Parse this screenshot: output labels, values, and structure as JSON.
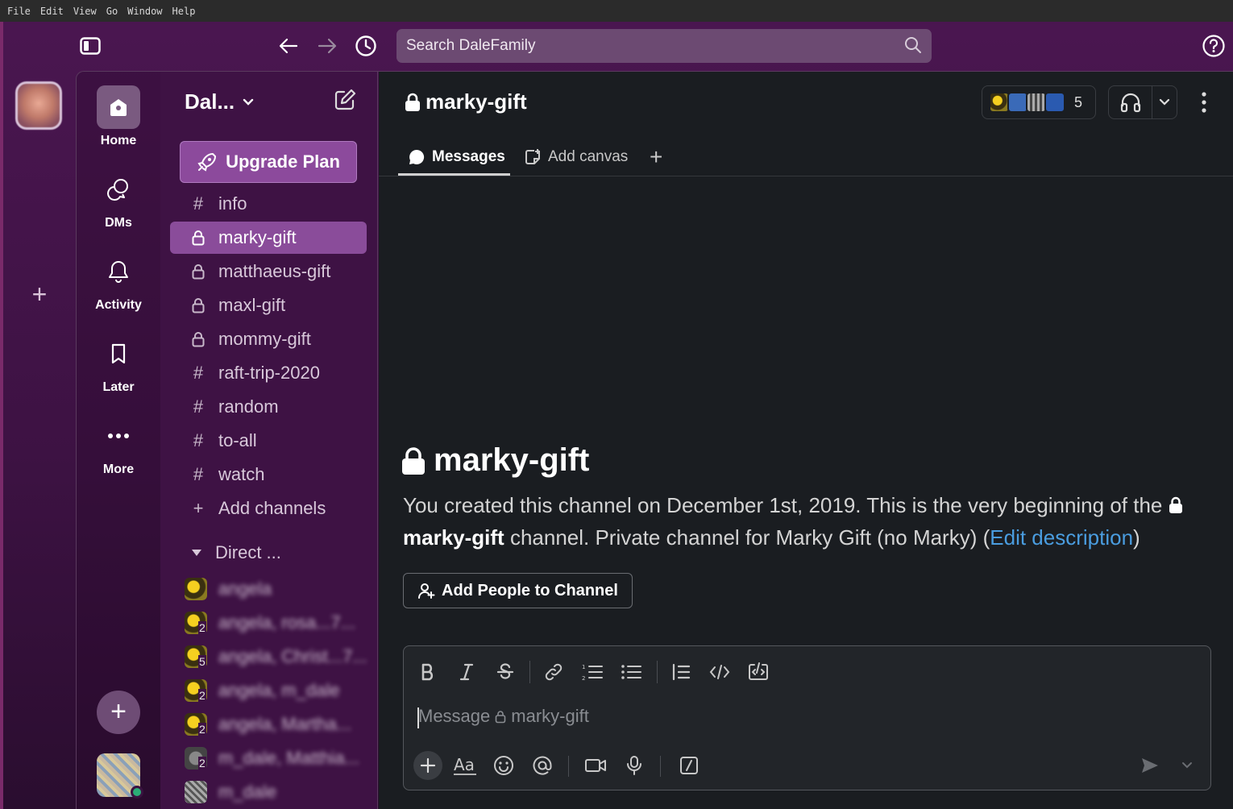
{
  "os_menu": [
    "File",
    "Edit",
    "View",
    "Go",
    "Window",
    "Help"
  ],
  "topbar": {
    "search_placeholder": "Search DaleFamily"
  },
  "nav": {
    "home": "Home",
    "dms": "DMs",
    "activity": "Activity",
    "later": "Later",
    "more": "More"
  },
  "sidebar": {
    "workspace_name": "Dal...",
    "upgrade_label": "Upgrade Plan",
    "channels": [
      {
        "name": "info",
        "type": "public"
      },
      {
        "name": "marky-gift",
        "type": "private",
        "active": true
      },
      {
        "name": "matthaeus-gift",
        "type": "private"
      },
      {
        "name": "maxl-gift",
        "type": "private"
      },
      {
        "name": "mommy-gift",
        "type": "private"
      },
      {
        "name": "raft-trip-2020",
        "type": "public"
      },
      {
        "name": "random",
        "type": "public"
      },
      {
        "name": "to-all",
        "type": "public"
      },
      {
        "name": "watch",
        "type": "public"
      }
    ],
    "add_channels": "Add channels",
    "direct_header": "Direct ...",
    "dms": [
      {
        "name": "angela",
        "count": ""
      },
      {
        "name": "angela, rosa...7...",
        "count": "2"
      },
      {
        "name": "angela, Christ...7...",
        "count": "5"
      },
      {
        "name": "angela, m_dale",
        "count": "2"
      },
      {
        "name": "angela, Martha...",
        "count": "2"
      },
      {
        "name": "m_dale, Matthia...",
        "count": "2"
      },
      {
        "name": "m_dale",
        "count": ""
      }
    ]
  },
  "main": {
    "channel_title": "marky-gift",
    "member_count": "5",
    "tabs": {
      "messages": "Messages",
      "add_canvas": "Add canvas"
    },
    "intro": {
      "title": "marky-gift",
      "line_part1": "You created this channel on December 1st, 2019. This is the very beginning of the",
      "channel_name": "marky-gift",
      "line_part2": "channel. Private channel for Marky Gift (no Marky) (",
      "edit_link": "Edit description",
      "line_part3": ")"
    },
    "add_people": "Add People to Channel",
    "composer": {
      "placeholder_prefix": "Message",
      "placeholder_channel": "marky-gift"
    }
  },
  "colors": {
    "sidebar_bg": "#3e1244",
    "active_channel": "#8a4c9a",
    "upgrade_button": "#8c4a9c",
    "main_bg": "#1a1d21",
    "link": "#4a9de0",
    "presence_online": "#2bac76"
  }
}
